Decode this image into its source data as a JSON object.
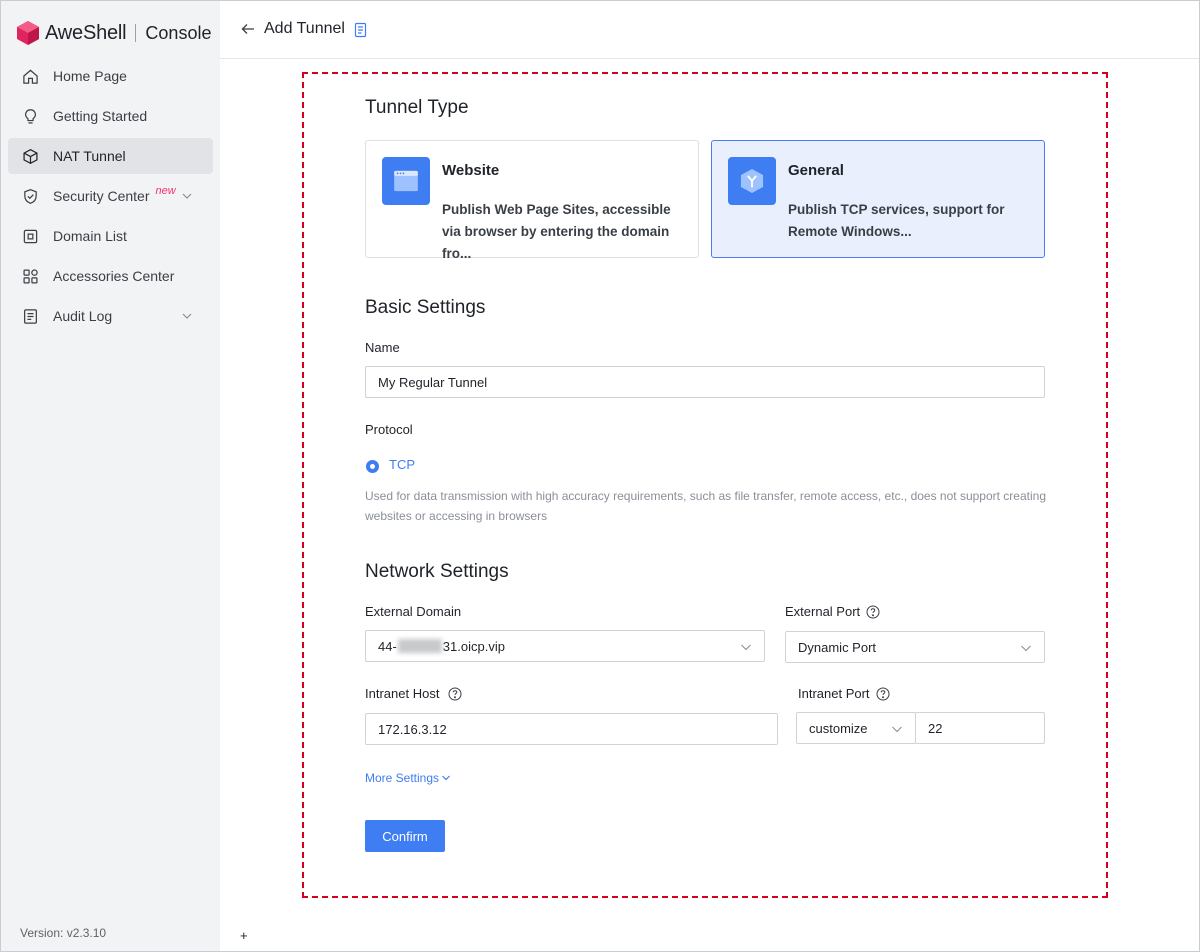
{
  "brand": {
    "name": "AweShell",
    "console": "Console",
    "logo_color": "#e0245e"
  },
  "sidebar": {
    "items": [
      {
        "label": "Home Page",
        "icon": "home-icon"
      },
      {
        "label": "Getting Started",
        "icon": "lightbulb-icon"
      },
      {
        "label": "NAT Tunnel",
        "icon": "cube-icon",
        "active": true
      },
      {
        "label": "Security Center",
        "icon": "shield-icon",
        "badge": "new",
        "expandable": true
      },
      {
        "label": "Domain List",
        "icon": "domain-icon"
      },
      {
        "label": "Accessories Center",
        "icon": "grid-icon"
      },
      {
        "label": "Audit Log",
        "icon": "log-icon",
        "expandable": true
      }
    ],
    "version": "Version: v2.3.10"
  },
  "header": {
    "title": "Add Tunnel"
  },
  "footer_mark": "+",
  "form": {
    "tunnel_type_title": "Tunnel Type",
    "tunnel_types": [
      {
        "title": "Website",
        "description": "Publish Web Page Sites, accessible via browser by entering the domain fro...",
        "icon": "browser-window-icon",
        "selected": false
      },
      {
        "title": "General",
        "description": "Publish TCP services, support for Remote Windows...",
        "icon": "hexagon-y-icon",
        "selected": true
      }
    ],
    "basic_settings_title": "Basic Settings",
    "name_label": "Name",
    "name_value": "My Regular Tunnel",
    "protocol_label": "Protocol",
    "protocol_option": "TCP",
    "protocol_hint": "Used for data transmission with high accuracy requirements, such as file transfer, remote access, etc., does not support creating websites or accessing in browsers",
    "network_settings_title": "Network Settings",
    "external_domain_label": "External Domain",
    "external_domain_prefix": "44-",
    "external_domain_suffix": "31.oicp.vip",
    "external_port_label": "External Port",
    "external_port_value": "Dynamic Port",
    "intranet_host_label": "Intranet Host",
    "intranet_host_value": "172.16.3.12",
    "intranet_port_label": "Intranet Port",
    "intranet_port_mode": "customize",
    "intranet_port_value": "22",
    "more_settings": "More Settings",
    "confirm_label": "Confirm"
  },
  "colors": {
    "accent": "#3f7df2",
    "highlight_border": "#d6001c",
    "selected_bg": "#e9effd"
  }
}
